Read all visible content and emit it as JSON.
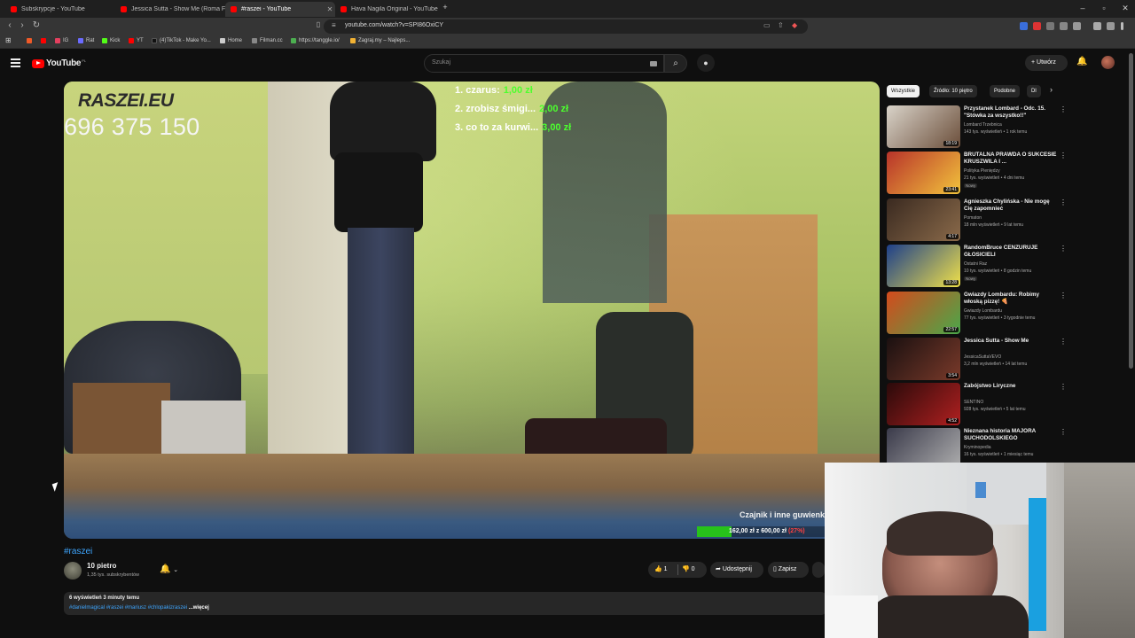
{
  "browser": {
    "tabs": [
      {
        "label": "Subskrypcje - YouTube",
        "active": false
      },
      {
        "label": "Jessica Sutta - Show Me (Roma F",
        "active": false
      },
      {
        "label": "#raszei - YouTube",
        "active": true
      },
      {
        "label": "Hava Nagila Original - YouTube",
        "active": false
      }
    ],
    "new_tab": "+",
    "url": "youtube.com/watch?v=SPI86OxiCY",
    "bookmarks": [
      "IG",
      "Rat",
      "Kick",
      "YT",
      "(4)TikTok - Make Yo...",
      "Home",
      "Filman.cc",
      "https://tanggle.io/",
      "Zagraj.my – Najleps..."
    ],
    "bookmark_colors": [
      "#e4405f",
      "#6b6bff",
      "#53fc18",
      "#ff0000",
      "#222222",
      "#cccccc",
      "#888888",
      "#4caf50",
      "#f2b233"
    ]
  },
  "youtube": {
    "logo_text": "YouTube",
    "logo_country": "PL",
    "search_placeholder": "Szukaj",
    "create_label": "Utwórz"
  },
  "video": {
    "overlay_brand": "RASZEI.EU",
    "overlay_phone": "696 375 150",
    "donations": [
      {
        "name": "1. czarus:",
        "amount": "1,00 zł"
      },
      {
        "name": "2. zrobisz śmigi...",
        "amount": "2,00 zł"
      },
      {
        "name": "3. co to za kurwi...",
        "amount": "3,00 zł"
      }
    ],
    "goal_title": "Czajnik i inne guwienk",
    "goal_amount": "162,00 zł z 600,00 zł",
    "goal_percent": "(27%)",
    "goal_fraction": 0.27
  },
  "meta": {
    "title": "#raszei",
    "channel": "10 pietro",
    "subscribers": "1,35 tys. subskrybentów",
    "likes": "1",
    "dislikes": "0",
    "share": "Udostępnij",
    "save": "Zapisz",
    "views_time": "6 wyświetleń  3 minuty temu",
    "tags": "#danielmagical #raszei #mariusz #chlopakizraszei",
    "more": "...więcej"
  },
  "sidebar": {
    "chips": [
      "Wszystkie",
      "Źródło: 10 piętro",
      "Podobne",
      "Dl"
    ],
    "recommendations": [
      {
        "title": "Przystanek Lombard - Odc. 15. \"Stówka za wszystko!!\"",
        "channel": "Lombard Trzebnica",
        "meta": "143 tys. wyświetleń • 1 rok temu",
        "duration": "18:19",
        "badge": "",
        "c1": "#d9d3c9",
        "c2": "#6b4e3a"
      },
      {
        "title": "BRUTALNA PRAWDA O SUKCESIE KRUSZWILA I ...",
        "channel": "Polityka Pieniędzy",
        "meta": "21 tys. wyświetleń • 4 dni temu",
        "duration": "23:41",
        "badge": "Nowy",
        "c1": "#b8332a",
        "c2": "#f2c33c"
      },
      {
        "title": "Agnieszka Chylińska - Nie mogę Cię zapomnieć",
        "channel": "Pomaton",
        "meta": "18 mln wyświetleń • 9 lat temu",
        "duration": "4:17",
        "badge": "",
        "c1": "#3a2a20",
        "c2": "#8a6a4a"
      },
      {
        "title": "RandomBruce CENZURUJE GŁOSICIELI",
        "channel": "Ostatni Raz",
        "meta": "10 tys. wyświetleń • 8 godzin temu",
        "duration": "13:28",
        "badge": "Nowy",
        "c1": "#1d3f8a",
        "c2": "#f0e14a"
      },
      {
        "title": "Gwiazdy Lombardu: Robimy włoską pizzę! 🍕",
        "channel": "Gwiazdy Lombardu",
        "meta": "77 tys. wyświetleń • 3 tygodnie temu",
        "duration": "22:57",
        "badge": "",
        "c1": "#d44a1c",
        "c2": "#4aa84a"
      },
      {
        "title": "Jessica Sutta - Show Me",
        "channel": "JessicaSuttaVEVO",
        "meta": "3,2 mln wyświetleń • 14 lat temu",
        "duration": "3:54",
        "badge": "",
        "c1": "#1a1010",
        "c2": "#7a3a2a"
      },
      {
        "title": "Zabójstwo Liryczne",
        "channel": "SENTINO",
        "meta": "928 tys. wyświetleń • 5 lat temu",
        "duration": "4:52",
        "badge": "",
        "c1": "#2a0a0a",
        "c2": "#b02020"
      },
      {
        "title": "Nieznana historia MAJORA SUCHODOLSKIEGO",
        "channel": "Kryminopedia",
        "meta": "16 tys. wyświetleń • 1 miesiąc temu",
        "duration": "",
        "badge": "",
        "c1": "#3a3a4a",
        "c2": "#b0b0b0"
      }
    ]
  }
}
